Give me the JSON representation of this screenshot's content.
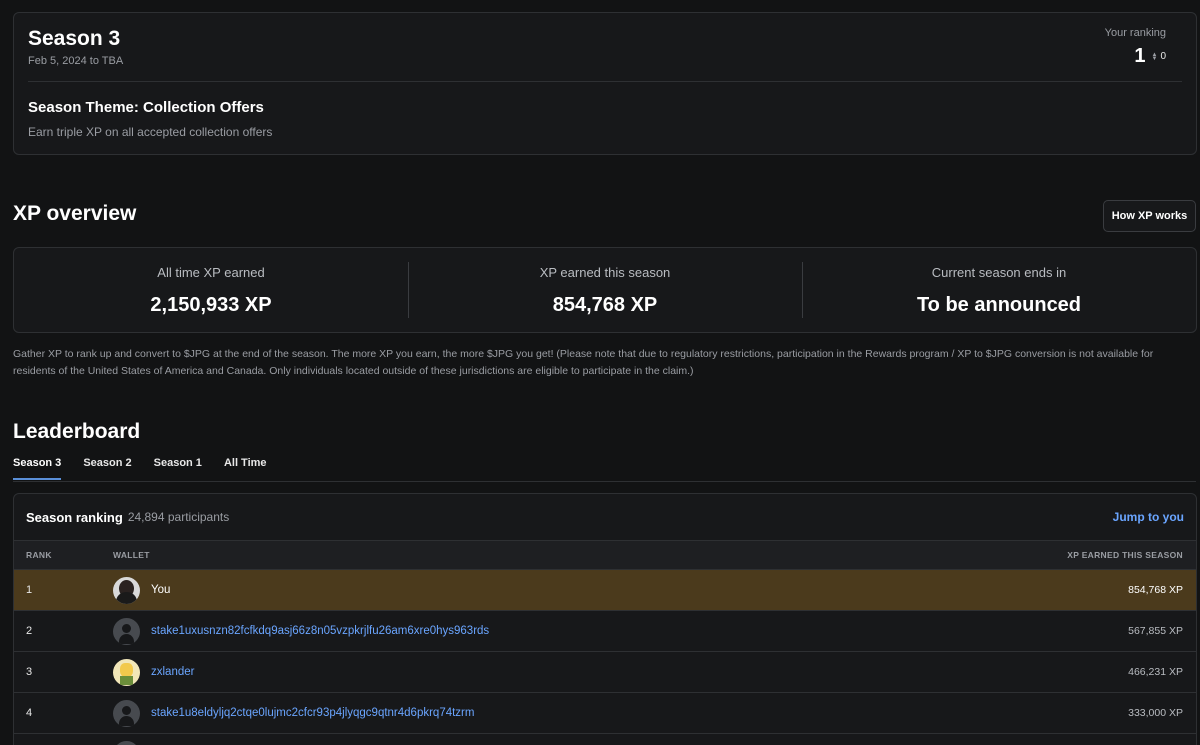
{
  "season": {
    "title": "Season 3",
    "dates": "Feb 5, 2024 to TBA",
    "ranking_label": "Your ranking",
    "ranking_value": "1",
    "ranking_change": "0",
    "theme_title": "Season Theme: Collection Offers",
    "theme_desc": "Earn triple XP on all accepted collection offers"
  },
  "xp_overview": {
    "heading": "XP overview",
    "how_button": "How XP works",
    "stats": [
      {
        "label": "All time XP earned",
        "value": "2,150,933 XP"
      },
      {
        "label": "XP earned this season",
        "value": "854,768 XP"
      },
      {
        "label": "Current season ends in",
        "value": "To be announced"
      }
    ],
    "note": "Gather XP to rank up and convert to $JPG at the end of the season. The more XP you earn, the more $JPG you get! (Please note that due to regulatory restrictions, participation in the Rewards program / XP to $JPG conversion is not available for residents of the United States of America and Canada. Only individuals located outside of these jurisdictions are eligible to participate in the claim.)"
  },
  "leaderboard": {
    "heading": "Leaderboard",
    "tabs": [
      "Season 3",
      "Season 2",
      "Season 1",
      "All Time"
    ],
    "active_tab": "Season 3",
    "ranking_title": "Season ranking",
    "participants": "24,894 participants",
    "jump_link": "Jump to you",
    "columns": [
      "RANK",
      "WALLET",
      "XP EARNED THIS SEASON"
    ],
    "rows": [
      {
        "rank": "1",
        "wallet": "You",
        "xp": "854,768 XP",
        "avatar": "photo-avatar-icon"
      },
      {
        "rank": "2",
        "wallet": "stake1uxusnzn82fcfkdq9asj66z8n05vzpkrjlfu26am6xre0hys963rds",
        "xp": "567,855 XP",
        "avatar": "user-avatar-icon"
      },
      {
        "rank": "3",
        "wallet": "zxlander",
        "xp": "466,231 XP",
        "avatar": "cartoon-avatar-icon"
      },
      {
        "rank": "4",
        "wallet": "stake1u8eldyljq2ctqe0lujmc2cfcr93p4jlyqgc9qtnr4d6pkrq74tzrm",
        "xp": "333,000 XP",
        "avatar": "user-avatar-icon"
      }
    ]
  },
  "colors": {
    "background": "#121314",
    "card": "#17181a",
    "accent_link": "#6aa5ff",
    "highlight_row": "#4b3a1c",
    "tab_underline": "#5a8fd8"
  }
}
